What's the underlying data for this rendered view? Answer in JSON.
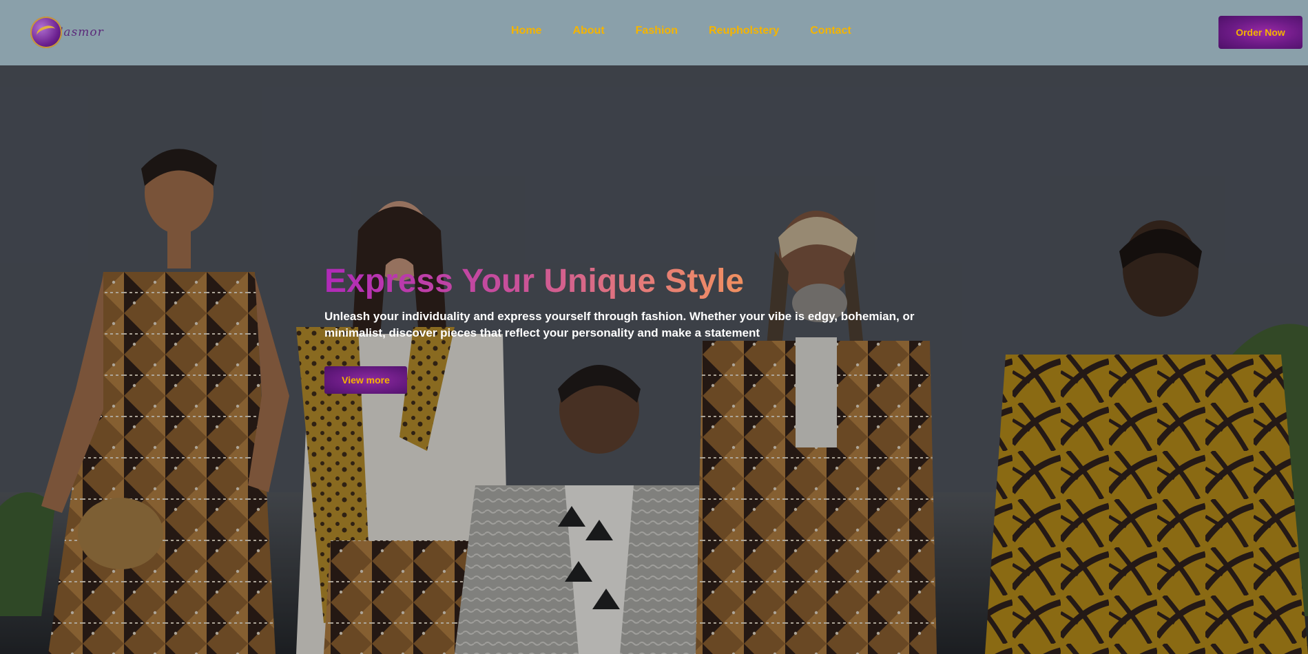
{
  "brand": {
    "logo_text": "lasmor"
  },
  "nav": {
    "links": [
      {
        "label": "Home"
      },
      {
        "label": "About"
      },
      {
        "label": "Fashion"
      },
      {
        "label": "Reupholstery"
      },
      {
        "label": "Contact"
      }
    ],
    "order_label": "Order Now"
  },
  "hero": {
    "headline": "Express Your Unique Style",
    "subtext": "Unleash your individuality and express yourself through fashion. Whether your vibe is edgy, bohemian, or minimalist, discover pieces that reflect your personality and make a statement",
    "cta_label": "View more"
  },
  "colors": {
    "nav_bg": "#8aa0aa",
    "accent_gold": "#f5b400",
    "accent_purple": "#6a1a84"
  }
}
